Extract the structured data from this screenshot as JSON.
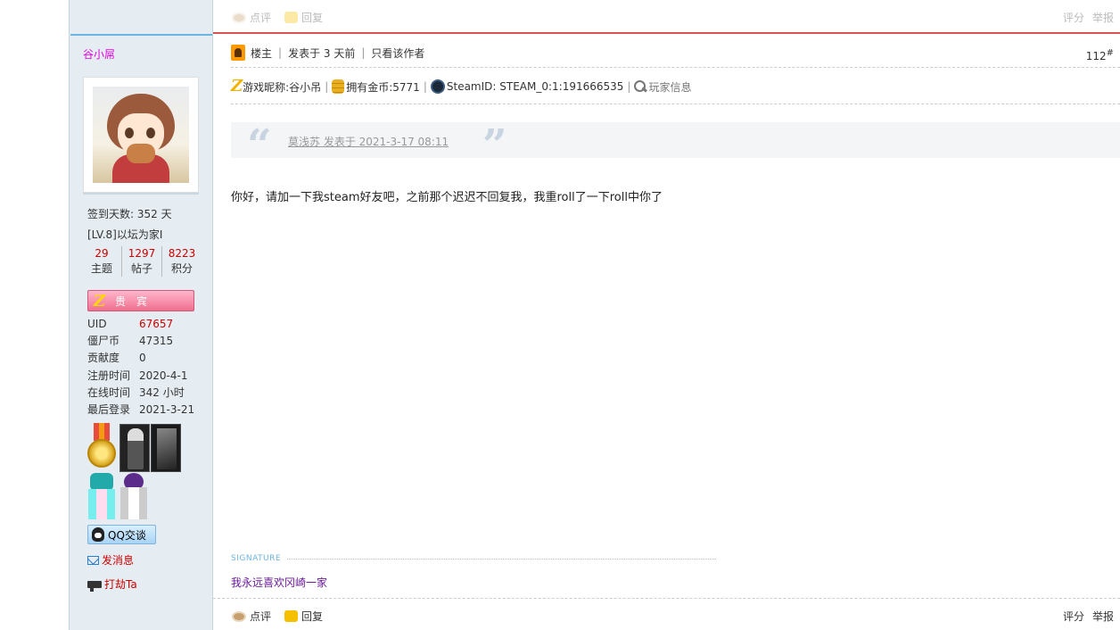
{
  "prev_post_actions": {
    "rate_label": "点评",
    "reply_label": "回复",
    "score_label": "评分",
    "report_label": "举报"
  },
  "user": {
    "name": "谷小屌",
    "checkin_days": "签到天数: 352 天",
    "level": "[LV.8]以坛为家I",
    "counts": [
      {
        "num": "29",
        "label": "主题"
      },
      {
        "num": "1297",
        "label": "帖子"
      },
      {
        "num": "8223",
        "label": "积分"
      }
    ],
    "vip_badge": "贵宾",
    "info": [
      {
        "k": "UID",
        "v": "67657"
      },
      {
        "k": "僵尸币",
        "v": "47315"
      },
      {
        "k": "贡献度",
        "v": "0"
      },
      {
        "k": "注册时间",
        "v": "2020-4-1"
      },
      {
        "k": "在线时间",
        "v": "342 小时"
      },
      {
        "k": "最后登录",
        "v": "2021-3-21"
      }
    ],
    "qq_label": "QQ交谈",
    "message_label": "发消息",
    "rob_label": "打劫Ta"
  },
  "post": {
    "host_label": "楼主",
    "posted": "发表于 3 天前",
    "only_author": "只看该作者",
    "floor": "112",
    "floor_sup": "#",
    "game_nick": "游戏昵称:谷小吊",
    "coins": "拥有金币:5771",
    "steam_id": "SteamID: STEAM_0:1:191666535",
    "player_info": "玩家信息",
    "quote": "莫浅苏 发表于 2021-3-17 08:11",
    "body": "你好，请加一下我steam好友吧，之前那个迟迟不回复我，我重roll了一下roll中你了",
    "signature_label": "SIGNATURE",
    "signature": "我永远喜欢冈崎一家",
    "rate_label": "点评",
    "reply_label": "回复",
    "score_label": "评分",
    "report_label": "举报"
  }
}
